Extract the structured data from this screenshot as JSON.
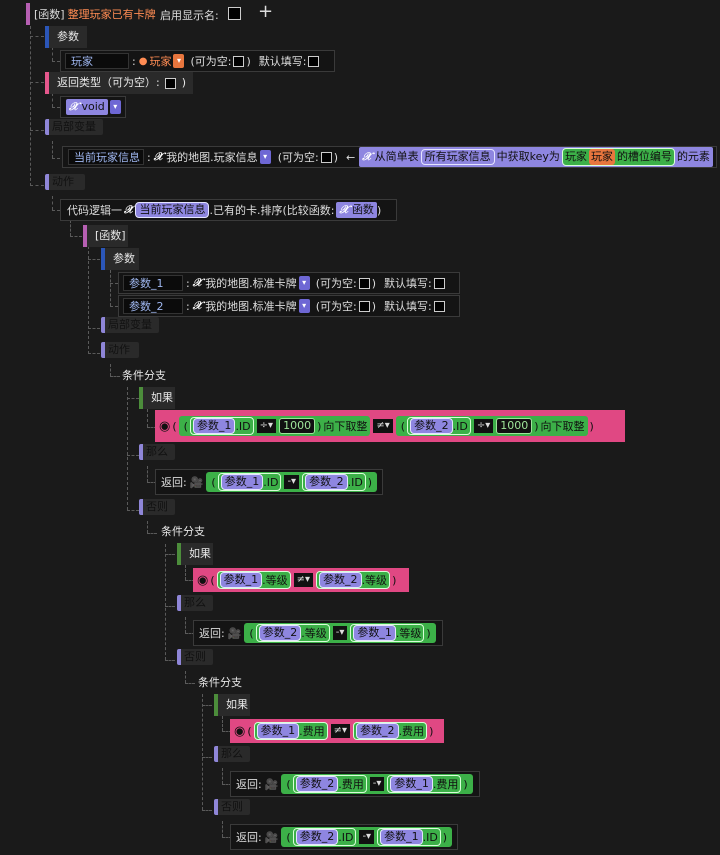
{
  "func": {
    "tag": "[函数]",
    "name": "整理玩家已有卡牌",
    "enable_label": "启用显示名:",
    "add": "+"
  },
  "labels": {
    "params": "参数",
    "return_type": "返回类型（可为空）:",
    "local_vars": "局部变量",
    "actions": "动作",
    "nullable": "(可为空:",
    "close_paren": ")",
    "default_fill": "默认填写:",
    "colon": ":",
    "lparen": "(",
    "rparen": ")",
    "arrow": "←",
    "x": "𝒳",
    "dot": ".",
    "down_round": "向下取整",
    "return": "返回:",
    "if": "如果",
    "then": "那么",
    "else": "否则",
    "cond_branch": "条件分支"
  },
  "param_player": {
    "name": "玩家",
    "type": "玩家"
  },
  "return_type": "void",
  "local_var": {
    "name": "当前玩家信息",
    "type": "我的地图.玩家信息",
    "from_table": "从简单表",
    "table": "所有玩家信息",
    "get_key": "中获取key为",
    "key_type": "玩家",
    "key_val": "玩家",
    "slot": "的槽位编号",
    "elem": "的元素"
  },
  "code_logic": {
    "label": "代码逻辑一",
    "var": "当前玩家信息",
    "field": ".已有的卡",
    "sort": ".排序(比较函数:",
    "func": "函数"
  },
  "inner_func": {
    "tag": "[函数]",
    "params": [
      {
        "name": "参数_1",
        "type": "我的地图.标准卡牌"
      },
      {
        "name": "参数_2",
        "type": "我的地图.标准卡牌"
      }
    ]
  },
  "expr": {
    "p1": "参数_1",
    "p2": "参数_2",
    "id": ".ID",
    "level": ".等级",
    "cost": ".费用",
    "div": "÷",
    "neq": "≠",
    "minus": "-",
    "n1000": "1000"
  }
}
